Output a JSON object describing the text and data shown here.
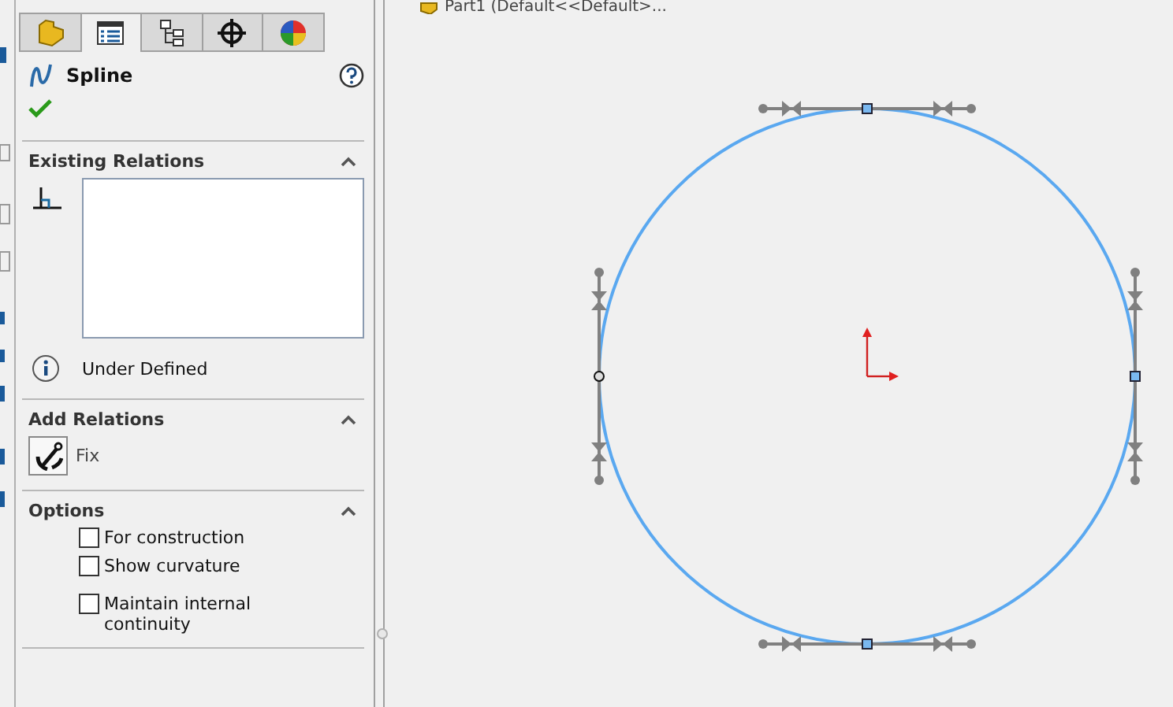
{
  "document_title": "Part1 (Default<<Default>...",
  "tabs": [
    {
      "kind": "feature",
      "selected": false
    },
    {
      "kind": "property",
      "selected": true
    },
    {
      "kind": "configuration",
      "selected": false
    },
    {
      "kind": "dimxpert",
      "selected": false
    },
    {
      "kind": "display",
      "selected": false
    }
  ],
  "feature": {
    "title": "Spline"
  },
  "existing_relations": {
    "title": "Existing Relations",
    "expanded": true,
    "status": "Under Defined"
  },
  "add_relations": {
    "title": "Add Relations",
    "expanded": true,
    "relations": [
      {
        "label": "Fix"
      }
    ]
  },
  "options": {
    "title": "Options",
    "expanded": true,
    "items": [
      {
        "label": "For construction",
        "checked": false
      },
      {
        "label": "Show curvature",
        "checked": false
      },
      {
        "label": "Maintain internal continuity",
        "checked": false
      }
    ]
  }
}
